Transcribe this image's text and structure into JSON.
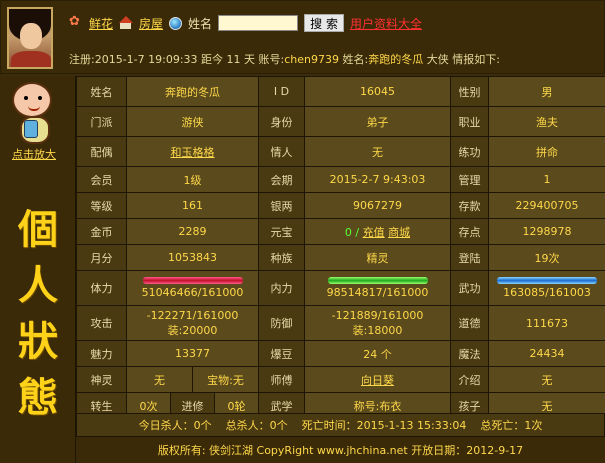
{
  "header": {
    "nav": {
      "flower": "鲜花",
      "house": "房屋",
      "name_label": "姓名",
      "search_value": "",
      "search_button": "搜 索",
      "all_users": "用户资料大全"
    },
    "reg": {
      "prefix": "注册:2015-1-7 19:09:33 距今 11 天 账号:",
      "account": "chen9739",
      "mid": " 姓名:",
      "name": "奔跑的冬瓜",
      "suffix": " 大侠 情报如下:"
    }
  },
  "left": {
    "zoom_link": "点击放大",
    "title_chars": [
      "個",
      "人",
      "狀",
      "態"
    ]
  },
  "rows": {
    "r1": {
      "l1": "姓名",
      "v1": "奔跑的冬瓜",
      "l2": "I D",
      "v2": "16045",
      "l3": "性别",
      "v3": "男"
    },
    "r2": {
      "l1": "门派",
      "v1": "游侠",
      "l2": "身份",
      "v2": "弟子",
      "l3": "职业",
      "v3": "渔夫"
    },
    "r3": {
      "l1": "配偶",
      "v1": "和玉格格",
      "l2": "情人",
      "v2": "无",
      "l3": "练功",
      "v3": "拼命"
    },
    "r4": {
      "l1": "会员",
      "v1": "1级",
      "l2": "会期",
      "v2": "2015-2-7 9:43:03",
      "l3": "管理",
      "v3": "1"
    },
    "r5": {
      "l1": "等级",
      "v1": "161",
      "l2": "银两",
      "v2": "9067279",
      "l3": "存款",
      "v3": "229400705"
    },
    "r6": {
      "l1": "金币",
      "v1": "2289",
      "l2": "元宝",
      "v2_prefix": "0 /",
      "v2_recharge": "充值",
      "v2_shop": "商城",
      "l3": "存点",
      "v3": "1298978"
    },
    "r7": {
      "l1": "月分",
      "v1": "1053843",
      "l2": "种族",
      "v2": "精灵",
      "l3": "登陆",
      "v3": "19次"
    },
    "r8": {
      "l1": "体力",
      "v1": "51046466/161000",
      "l2": "内力",
      "v2": "98514817/161000",
      "l3": "武功",
      "v3": "163085/161003"
    },
    "r9": {
      "l1": "攻击",
      "v1a": "-122271/161000",
      "v1b": "装:20000",
      "l2": "防御",
      "v2a": "-121889/161000",
      "v2b": "装:18000",
      "l3": "道德",
      "v3": "111673"
    },
    "r10": {
      "l1": "魅力",
      "v1": "13377",
      "l2": "爆豆",
      "v2": "24 个",
      "l3": "魔法",
      "v3": "24434"
    },
    "r11": {
      "l1": "神灵",
      "v1a": "无",
      "v1b": "宝物:无",
      "l2": "师傅",
      "v2": "向日葵",
      "l3": "介绍",
      "v3": "无"
    },
    "r12": {
      "l1": "转生",
      "v1a": "0次",
      "v1b": "进修",
      "v1c": "0轮",
      "l2": "武学",
      "v2": "称号:布衣",
      "l3": "孩子",
      "v3": "无"
    }
  },
  "summary": {
    "today_kills": "今日杀人：0个",
    "total_kills": "总杀人：0个",
    "death_time": "死亡时间：2015-1-13 15:33:04",
    "total_deaths": "总死亡：1次"
  },
  "footer": {
    "text": "版权所有: 侠剑江湖 CopyRight www.jhchina.net   开放日期：2012-9-17"
  },
  "colors": {
    "label_bg": "#4a3a12",
    "value_bg": "#5a4a1c",
    "value_text": "#ffd84a",
    "title_gold": "#ffd21a",
    "red_link": "#ff3030"
  },
  "bars": {
    "stamina": 1.0,
    "inner": 1.0,
    "martial": 1.0
  }
}
